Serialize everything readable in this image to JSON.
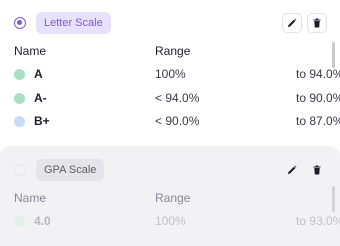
{
  "scales": [
    {
      "name": "Letter Scale",
      "selected": true,
      "headers": {
        "name": "Name",
        "range": "Range"
      },
      "rows": [
        {
          "grade": "A",
          "from": "100%",
          "to": "to 94.0%",
          "color": "#a8e0c3"
        },
        {
          "grade": "A-",
          "from": "< 94.0%",
          "to": "to 90.0%",
          "color": "#a8e0c3"
        },
        {
          "grade": "B+",
          "from": "< 90.0%",
          "to": "to 87.0%",
          "color": "#c9dcf7"
        }
      ]
    },
    {
      "name": "GPA Scale",
      "selected": false,
      "headers": {
        "name": "Name",
        "range": "Range"
      },
      "rows": [
        {
          "grade": "4.0",
          "from": "100%",
          "to": "to 93.0%",
          "color": "#dff0e7"
        }
      ]
    }
  ],
  "icons": {
    "edit": "pencil-icon",
    "delete": "trash-icon",
    "select": "radio-icon"
  },
  "colors": {
    "accent": "#7c5cd6",
    "chip_active_bg": "#e8e1fb",
    "inactive_card_bg": "#f2f1f4"
  }
}
